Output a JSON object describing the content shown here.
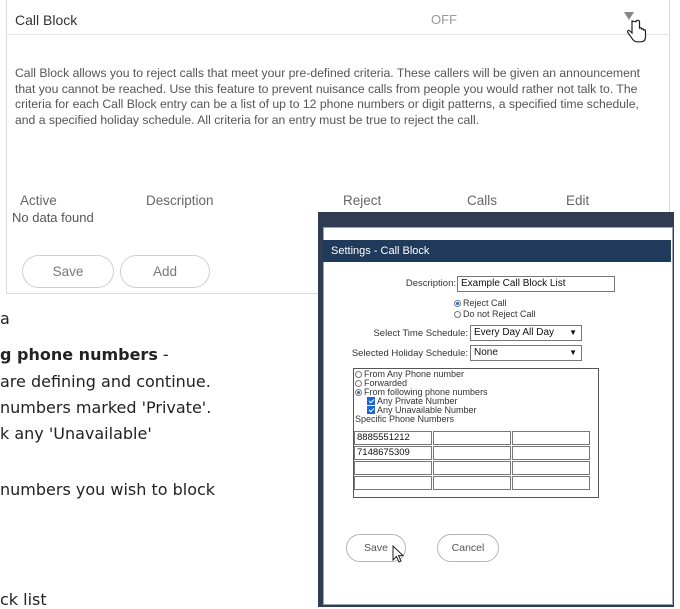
{
  "card": {
    "title": "Call Block",
    "status": "OFF",
    "description": "Call Block allows you to reject calls that meet your pre-defined criteria. These callers will be given an announcement that you cannot be reached. Use this feature to prevent nuisance calls from people you would rather not talk to. The criteria for each Call Block entry can be a list of up to 12 phone numbers or digit patterns, a specified time schedule, and a specified holiday schedule. All criteria for an entry must be true to reject the call.",
    "columns": [
      "Active",
      "Description",
      "Reject",
      "Calls",
      "Edit"
    ],
    "empty_text": "No data found",
    "save_label": "Save",
    "add_label": "Add"
  },
  "doc": {
    "line1": "a",
    "line2_bold": "g phone numbers",
    "line2_rest": " -",
    "line3": " are defining and continue.",
    "line4": "numbers marked 'Private'.",
    "line5": "k any 'Unavailable'",
    "line6": "numbers you wish to block",
    "line7": "ck list"
  },
  "dialog": {
    "title": "Settings - Call Block",
    "description_label": "Description:",
    "description_value": "Example Call Block List",
    "reject_call": "Reject Call",
    "do_not_reject": "Do not Reject Call",
    "time_schedule_label": "Select Time Schedule:",
    "time_schedule_value": "Every Day All Day",
    "holiday_schedule_label": "Selected Holiday Schedule:",
    "holiday_schedule_value": "None",
    "from_any": "From Any Phone number",
    "forwarded": "Forwarded",
    "from_following": "From following phone numbers",
    "any_private": "Any Private Number",
    "any_unavailable": "Any Unavailable Number",
    "specific_label": "Specific Phone Numbers",
    "numbers": [
      "8885551212",
      "7148675309"
    ],
    "save_label": "Save",
    "cancel_label": "Cancel"
  },
  "colors": {
    "titlebar": "#1f3a5a",
    "frame": "#2f3c54",
    "accent": "#1a66d6"
  }
}
